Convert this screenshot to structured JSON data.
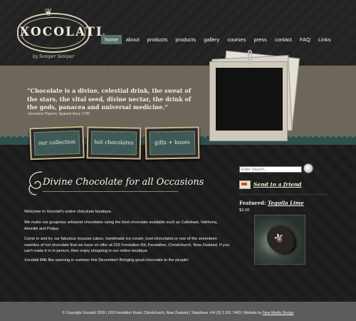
{
  "brand": {
    "name": "XOCOLATL",
    "tagline": "by Semper Semper",
    "crown": "❦"
  },
  "nav": [
    {
      "label": "home",
      "active": true
    },
    {
      "label": "about",
      "active": false
    },
    {
      "label": "products",
      "active": false
    },
    {
      "label": "products",
      "active": false
    },
    {
      "label": "gallery",
      "active": false
    },
    {
      "label": "courses",
      "active": false
    },
    {
      "label": "press",
      "active": false
    },
    {
      "label": "contact",
      "active": false
    },
    {
      "label": "FAQ",
      "active": false
    },
    {
      "label": "Links",
      "active": false
    }
  ],
  "quote": {
    "text": "“Chocolate is a divine, celestial drink, the sweat of the stars, the vital seed, divine nectar, the drink of the gods, panacea and universal medicine.”",
    "source": "-Geronimo Piperini, Spanish Army 1796"
  },
  "tags": [
    {
      "label": "our collection"
    },
    {
      "label": "hot chocolates"
    },
    {
      "label": "gifts + boxes"
    }
  ],
  "main": {
    "heading": "Divine Chocolate for all Occasions",
    "paragraphs": [
      "Welcome to Xocolatl's online chocolate boutique.",
      "We make our gorgeous artisanal chocolates using the best chocolate available such as Callebaut, Valrhona, Amedei and Pralus.",
      "Come in and try our fabulous mousse cakes, handmade ice cream, iced chocolates or one of the seventeen varieties of hot chocolate that we have on offer at 203 Fendalton Rd, Fendalton, Christchurch, New Zealand. If you can't make it in in person, then enjoy shopping in our online boutique.",
      "Xocolatl Milk Bar opening in summer this December! Bringing good chocolate to the people!"
    ]
  },
  "sidebar": {
    "search_placeholder": "Enter Search...",
    "send_friend": "Send to a friend",
    "featured_label": "Featured:",
    "featured_name": "Tequila Lime",
    "price": "$2.00"
  },
  "footer": {
    "text": "© Copyright Xocolatl 2009 | 203 Fendalton Road, Christchurch, New Zealand | Telephone +64 (0) 3 351 7460 | Website by ",
    "link": "New Media Design"
  }
}
